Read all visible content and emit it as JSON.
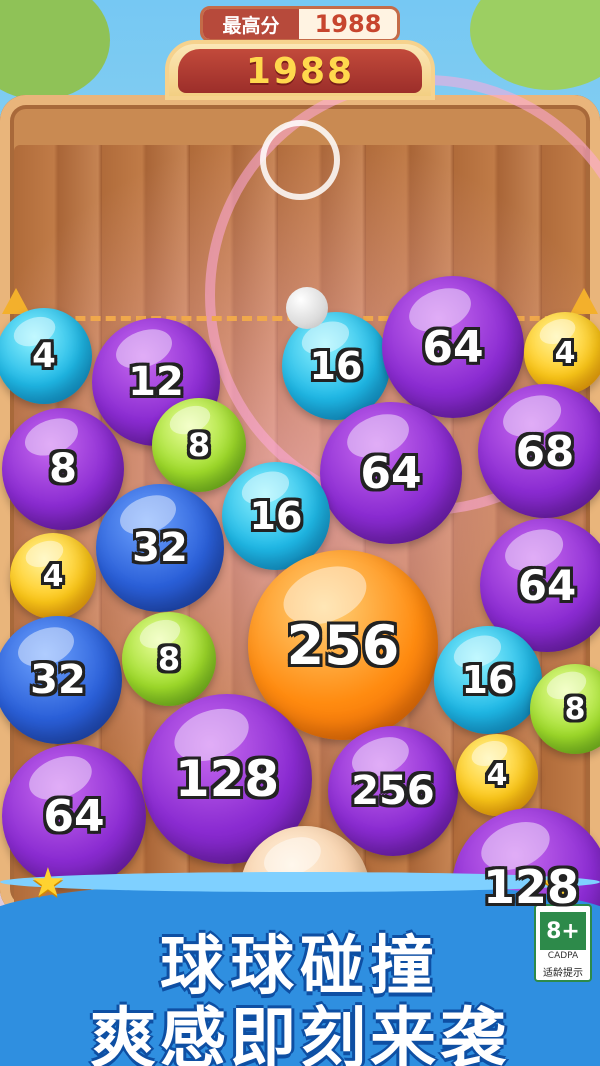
{
  "score": {
    "best_label": "最高分",
    "best_value": "1988",
    "current_value": "1988"
  },
  "balls": [
    {
      "value": "4",
      "color": "cyan"
    },
    {
      "value": "12",
      "color": "purple"
    },
    {
      "value": "16",
      "color": "cyan"
    },
    {
      "value": "64",
      "color": "purple"
    },
    {
      "value": "4",
      "color": "yellow"
    },
    {
      "value": "8",
      "color": "purple"
    },
    {
      "value": "8",
      "color": "green"
    },
    {
      "value": "64",
      "color": "purple"
    },
    {
      "value": "68",
      "color": "purple"
    },
    {
      "value": "16",
      "color": "cyan"
    },
    {
      "value": "32",
      "color": "blue"
    },
    {
      "value": "4",
      "color": "yellow"
    },
    {
      "value": "64",
      "color": "purple"
    },
    {
      "value": "256",
      "color": "orange"
    },
    {
      "value": "32",
      "color": "blue"
    },
    {
      "value": "8",
      "color": "green"
    },
    {
      "value": "16",
      "color": "cyan"
    },
    {
      "value": "8",
      "color": "green"
    },
    {
      "value": "128",
      "color": "purple"
    },
    {
      "value": "256",
      "color": "purple"
    },
    {
      "value": "4",
      "color": "yellow"
    },
    {
      "value": "64",
      "color": "purple"
    },
    {
      "value": "128",
      "color": "purple"
    }
  ],
  "banner": {
    "line1": "球球碰撞",
    "line2": "爽感即刻来袭"
  },
  "age_rating": {
    "value": "8+",
    "org": "CADPA",
    "tip": "适龄提示"
  }
}
